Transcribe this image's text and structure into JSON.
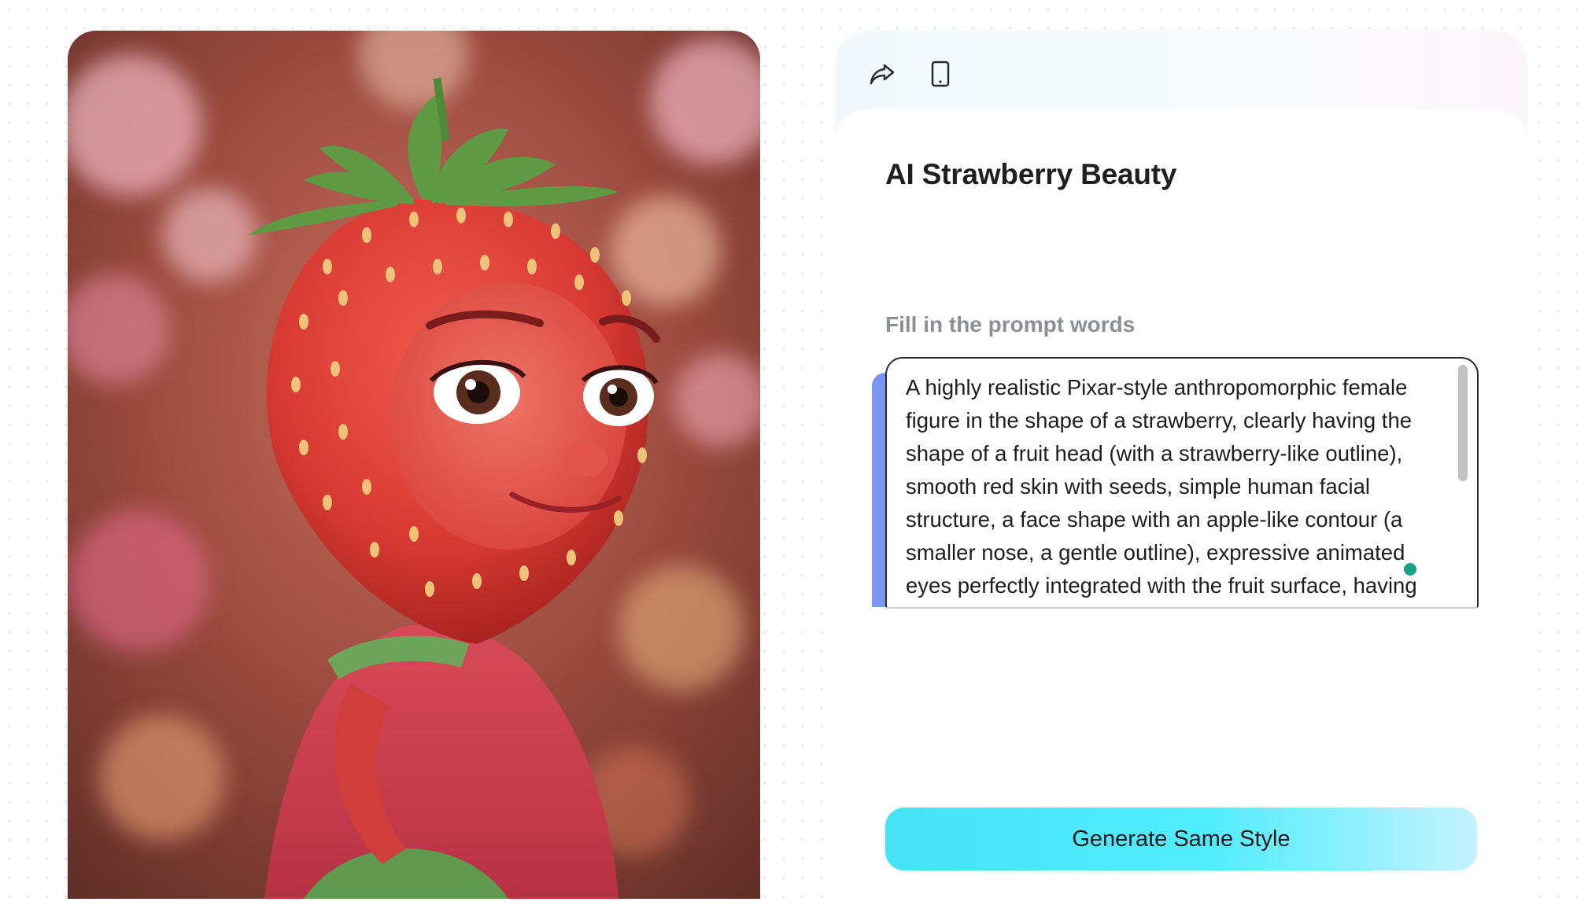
{
  "artwork": {
    "alt": "AI Strawberry Beauty artwork",
    "subject": "strawberry-headed character"
  },
  "toolbar": {
    "share_icon": "share-icon",
    "device_icon": "phone-icon"
  },
  "title": "AI Strawberry Beauty",
  "prompt": {
    "label": "Fill in the prompt words",
    "text": "A highly realistic Pixar-style anthropomorphic female figure in the shape of a strawberry, clearly having the shape of a fruit head (with a strawberry-like outline), smooth red skin with seeds, simple human facial structure, a face shape with an apple-like contour (a smaller nose, a gentle outline), expressive animated eyes perfectly integrated with the fruit surface, having"
  },
  "generate_button": {
    "label": "Generate Same Style"
  },
  "colors": {
    "accent_cyan": "#52ecff",
    "handle_blue": "#7b95f3",
    "label_gray": "#8b9097"
  }
}
